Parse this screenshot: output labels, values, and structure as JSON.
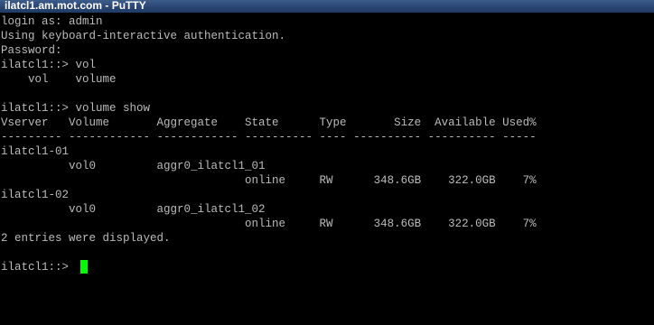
{
  "window": {
    "title": "ilatcl1.am.mot.com - PuTTY"
  },
  "terminal": {
    "lines": [
      "login as: admin",
      "Using keyboard-interactive authentication.",
      "Password:",
      "ilatcl1::> vol",
      "    vol    volume",
      "",
      "ilatcl1::> volume show",
      "Vserver   Volume       Aggregate    State      Type       Size  Available Used%",
      "--------- ------------ ------------ ---------- ---- ---------- ---------- -----",
      "ilatcl1-01",
      "          vol0         aggr0_ilatcl1_01",
      "                                    online     RW      348.6GB    322.0GB    7%",
      "ilatcl1-02",
      "          vol0         aggr0_ilatcl1_02",
      "                                    online     RW      348.6GB    322.0GB    7%",
      "2 entries were displayed.",
      "",
      "ilatcl1::> "
    ],
    "cursor_color": "#00ff00",
    "text_color": "#bbbbbb",
    "background_color": "#000000"
  }
}
